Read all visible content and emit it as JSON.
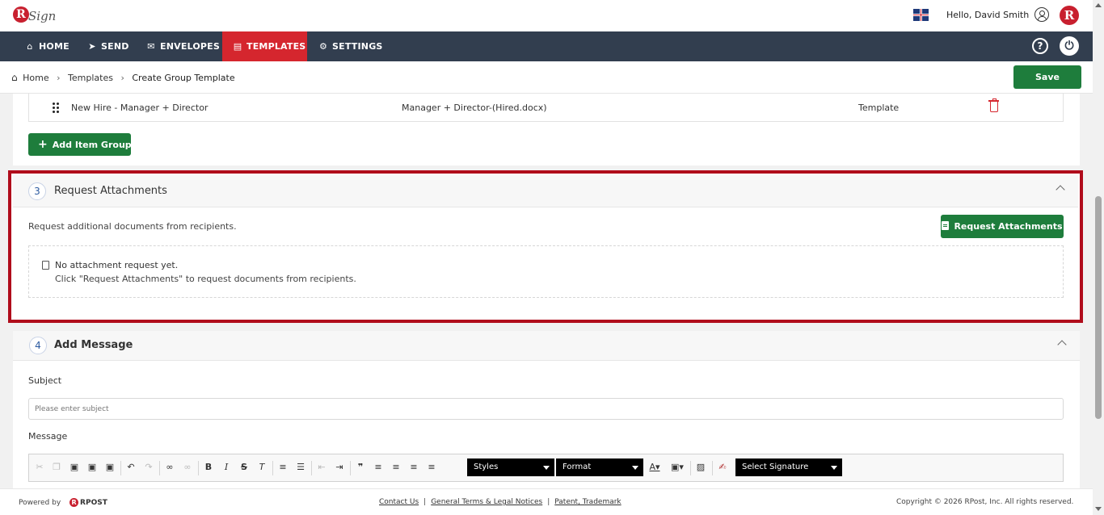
{
  "header": {
    "logo_brand": "R",
    "logo_text": "Sign",
    "greeting": "Hello, David Smith",
    "avatar_letter": "R"
  },
  "nav": {
    "items": [
      {
        "label": "HOME",
        "icon": "home-icon"
      },
      {
        "label": "SEND",
        "icon": "send-icon"
      },
      {
        "label": "ENVELOPES",
        "icon": "envelope-icon"
      },
      {
        "label": "TEMPLATES",
        "icon": "template-icon",
        "active": true
      },
      {
        "label": "SETTINGS",
        "icon": "gear-icon"
      }
    ],
    "help": "?",
    "power": "⏻"
  },
  "breadcrumb": {
    "items": [
      "Home",
      "Templates",
      "Create Group Template"
    ],
    "save_label": "Save"
  },
  "item_group": {
    "row": {
      "name": "New Hire - Manager + Director",
      "document": "Manager + Director-(Hired.docx)",
      "type": "Template"
    },
    "add_label": "Add Item Group"
  },
  "request_attachments": {
    "step": "3",
    "title": "Request Attachments",
    "description": "Request additional documents from recipients.",
    "button_label": "Request Attachments",
    "empty_title": "No attachment request yet.",
    "empty_hint": "Click \"Request Attachments\" to request documents from recipients."
  },
  "add_message": {
    "step": "4",
    "title": "Add Message",
    "subject_label": "Subject",
    "subject_placeholder": "Please enter subject",
    "message_label": "Message",
    "toolbar": {
      "styles": "Styles",
      "format": "Format",
      "signature": "Select Signature"
    }
  },
  "footer": {
    "powered_by": "Powered by",
    "rpost": "RPOST",
    "links": [
      "Contact Us",
      "General Terms & Legal Notices",
      "Patent, Trademark"
    ],
    "copyright": "Copyright © 2026 RPost, Inc. All rights reserved."
  },
  "colors": {
    "nav_bg": "#323e4f",
    "nav_active": "#d5262e",
    "button_green": "#1e7d3c",
    "highlight_border": "#b00c1b",
    "brand_red": "#c8202f"
  }
}
